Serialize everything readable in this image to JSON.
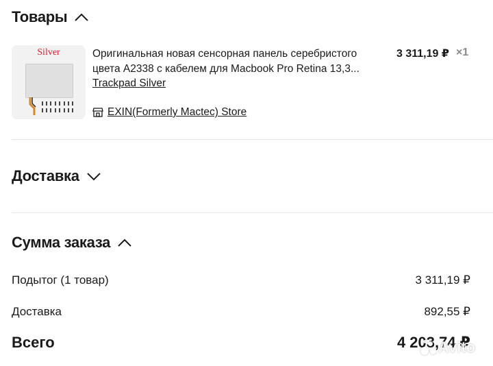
{
  "products": {
    "title": "Товары",
    "expanded": true,
    "item": {
      "thumbnail_label": "Silver",
      "title_line1": "Оригинальная новая сенсорная панель серебристого",
      "title_line2": "цвета A2338 с кабелем для Macbook Pro Retina 13,3...",
      "title_line3": "Trackpad Silver",
      "price": "3 311,19 ₽",
      "quantity": "×1",
      "store_icon": "store-icon",
      "store_name": "EXIN(Formerly Mactec) Store"
    }
  },
  "delivery": {
    "title": "Доставка",
    "expanded": false
  },
  "summary": {
    "title": "Сумма заказа",
    "expanded": true,
    "subtotal_label": "Подытог (1 товар)",
    "subtotal_value": "3 311,19 ₽",
    "delivery_label": "Доставка",
    "delivery_value": "892,55 ₽",
    "total_label": "Всего",
    "total_value": "4 203,74 ₽"
  },
  "watermark": "Avito",
  "colors": {
    "text": "#1a1a1a",
    "muted": "#8a8a8a",
    "divider": "#e6e6e6",
    "brand_red": "#d2252c"
  }
}
